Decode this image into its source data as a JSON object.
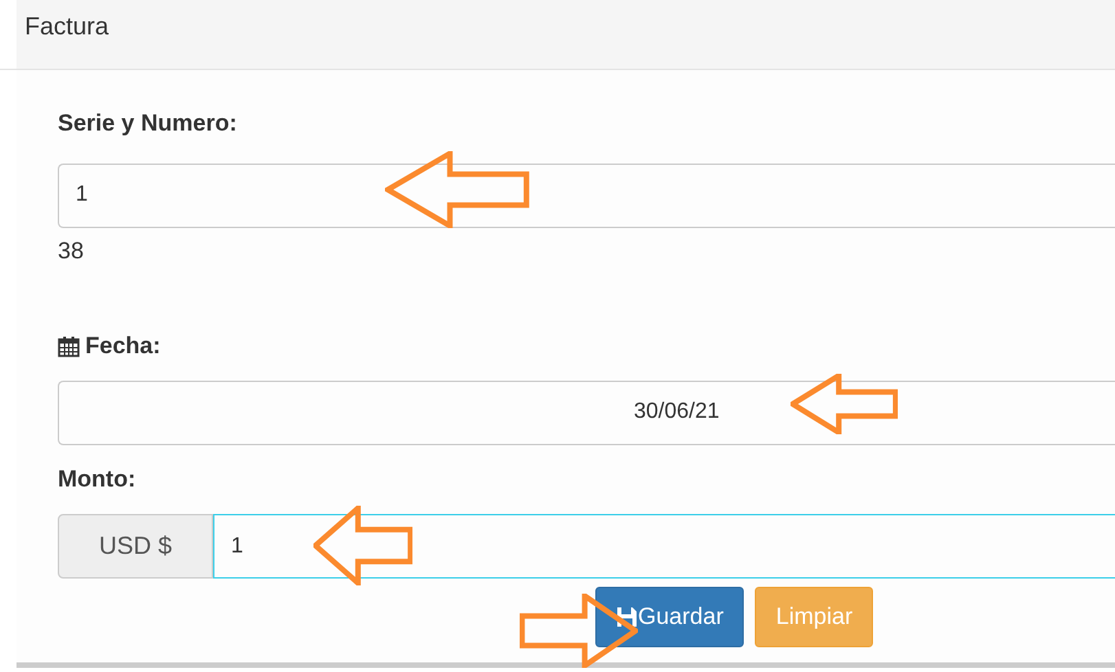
{
  "panel": {
    "title": "Factura"
  },
  "serie": {
    "label": "Serie y Numero:",
    "value": "1",
    "note": "38"
  },
  "fecha": {
    "label": "Fecha:",
    "value": "30/06/21"
  },
  "monto": {
    "label": "Monto:",
    "prefix": "USD $",
    "value": "1",
    "focused": true
  },
  "buttons": [
    {
      "label": "Guardar",
      "kind": "primary"
    },
    {
      "label": "Limpiar",
      "kind": "warning"
    }
  ]
}
